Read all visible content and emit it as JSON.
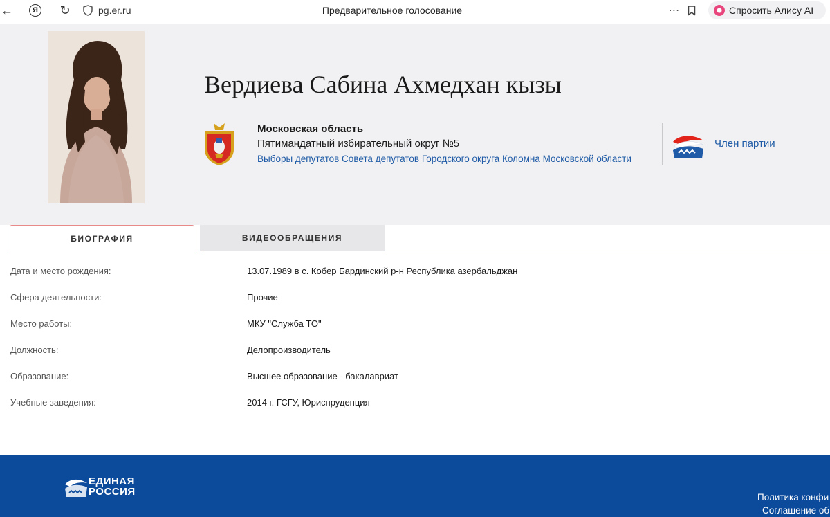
{
  "browser": {
    "url": "pg.er.ru",
    "tab_title": "Предварительное голосование",
    "alice_label": "Спросить Алису AI",
    "ya_glyph": "Я",
    "icons": [
      "back-arrow-icon",
      "yandex-icon",
      "reload-icon",
      "shield-icon",
      "more-icon",
      "bookmark-icon",
      "alice-icon"
    ]
  },
  "candidate": {
    "name": "Вердиева Сабина Ахмедхан кызы",
    "region": "Московская область",
    "district": "Пятимандатный избирательный округ №5",
    "election": "Выборы депутатов Совета депутатов Городского округа Коломна Московской области",
    "party_status": "Член партии"
  },
  "tabs": [
    {
      "label": "БИОГРАФИЯ",
      "active": true
    },
    {
      "label": "ВИДЕООБРАЩЕНИЯ",
      "active": false
    }
  ],
  "bio": [
    {
      "label": "Дата и место рождения:",
      "value": "13.07.1989 в с. Кобер Бардинский р-н Республика азербальджан"
    },
    {
      "label": "Сфера деятельности:",
      "value": "Прочие"
    },
    {
      "label": "Место работы:",
      "value": "МКУ \"Служба ТО\""
    },
    {
      "label": "Должность:",
      "value": "Делопроизводитель"
    },
    {
      "label": "Образование:",
      "value": "Высшее образование - бакалавриат"
    },
    {
      "label": "Учебные заведения:",
      "value": "2014 г. ГСГУ, Юриспруденция"
    }
  ],
  "footer": {
    "brand_line1": "ЕДИНАЯ",
    "brand_line2": "РОССИЯ",
    "link1": "Политика конфи",
    "link2": "Соглашение об"
  },
  "colors": {
    "link_blue": "#1f5ba6",
    "footer_blue": "#0c4a9b",
    "header_grey": "#f1f1f3",
    "tab_border": "#e88a8a"
  }
}
